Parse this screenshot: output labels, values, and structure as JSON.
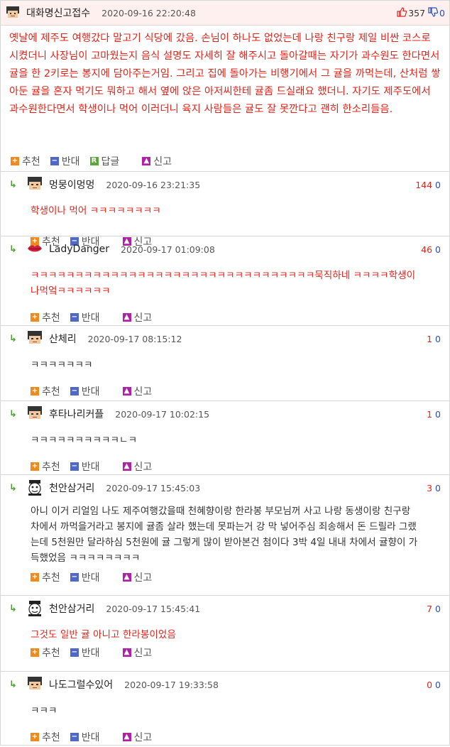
{
  "post": {
    "author": "대화명신고접수",
    "timestamp": "2020-09-16 22:20:48",
    "up_count": "357",
    "down_count": "0",
    "body": "옛날에 제주도 여행갔다 말고기 식당에 갔음. 손님이 하나도 없었는데 나랑 친구랑 제일 비싼 코스로 시켰더니 사장님이 고마웠는지 음식 설명도 자세히 잘 해주시고 돌아갈때는 자기가 과수원도 한다면서 귤을 한 2키로는 봉지에 담아주는거임. 그리고 집에 돌아가는 비행기에서 그 귤을 까먹는데, 산처럼 쌓아둔 귤을 혼자 먹기도 뭐하고 해서 옆에 앉은 아저씨한테 귤좀 드실래요 했더니. 자기도 제주도에서 과수원한다면서 학생이나 먹어 이러더니 육지 사람들은 귤도 잘 못깐다고 괜히 한소리들음.",
    "actions": {
      "recommend": "추천",
      "oppose": "반대",
      "reply": "답글",
      "report": "신고"
    }
  },
  "labels": {
    "recommend": "추천",
    "oppose": "반대",
    "report": "신고",
    "reply_icon": "↳"
  },
  "comments": [
    {
      "name": "멍뭉이멍멍",
      "timestamp": "2020-09-16 23:21:35",
      "up": "144",
      "down": "0",
      "text": "학생이나 먹어 ㅋㅋㅋㅋㅋㅋㅋㅋ",
      "avatar": "pixel-boy-icon"
    },
    {
      "name": "LadyDanger",
      "timestamp": "2020-09-17 01:09:08",
      "up": "46",
      "down": "0",
      "text": "ㅋㅋㅋㅋㅋㅋㅋㅋㅋㅋㅋㅋㅋㅋㅋㅋㅋㅋㅋㅋㅋㅋㅋㅋㅋㅋㅋㅋㅋㅋㅋㅋ묵직하네 ㅋㅋㅋㅋ학생이나먹엌ㅋㅋㅋㅋㅋㅋ",
      "avatar": "red-lips-icon"
    },
    {
      "name": "산체리",
      "timestamp": "2020-09-17 08:15:12",
      "up": "1",
      "down": "0",
      "text": "ㅋㅋㅋㅋㅋㅋㅋ",
      "avatar": "pixel-boy-icon"
    },
    {
      "name": "후타나리커플",
      "timestamp": "2020-09-17 10:02:15",
      "up": "1",
      "down": "0",
      "text": "ㅋㅋㅋㅋㅋㅋㅋㅋㅋㅋㄴㅋ",
      "avatar": "pixel-boy-icon"
    },
    {
      "name": "천안삼거리",
      "timestamp": "2020-09-17 15:45:03",
      "up": "3",
      "down": "0",
      "text": "아니 이거 리얼임 나도 제주여행갔을때 천혜향이랑 한라봉 부모님꺼 사고 나랑 동생이랑 친구랑 차에서 까먹을거라고 봉지에 귤좀 살라 했는데 못파는거 강 막 넣어주심 죄송해서 돈 드릴라 그랬는데 5천원만 달라하심 5천원에 귤 그렇게 많이 받아본건 첨이다 3박 4일 내내 차에서 귤향이 가득했었음 ㅋㅋㅋㅋㅋㅋㅋㅋ",
      "avatar": "cartoon-face-icon"
    },
    {
      "name": "천안삼거리",
      "timestamp": "2020-09-17 15:45:41",
      "up": "7",
      "down": "0",
      "text": "그것도 일반 귤 아니고 한라봉이었음",
      "avatar": "cartoon-face-icon"
    },
    {
      "name": "나도그럴수있어",
      "timestamp": "2020-09-17 19:33:58",
      "up": "0",
      "down": "0",
      "text": "ㅋㅋㅋ",
      "avatar": "pixel-boy-icon"
    }
  ]
}
